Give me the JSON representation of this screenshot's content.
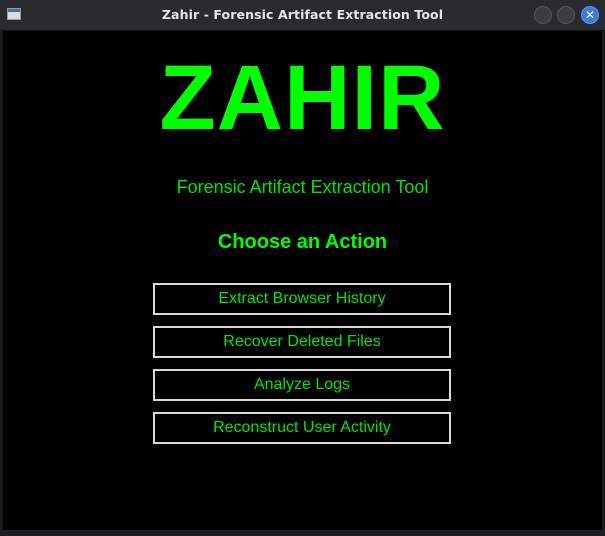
{
  "window": {
    "title": "Zahir - Forensic Artifact Extraction Tool",
    "app_icon": "window-icon",
    "controls": {
      "minimize_icon": "circle-icon",
      "maximize_icon": "circle-icon",
      "close_glyph": "✕"
    }
  },
  "main": {
    "logo": "ZAHIR",
    "subtitle": "Forensic Artifact Extraction Tool",
    "heading": "Choose an Action",
    "actions": [
      {
        "label": "Extract Browser History"
      },
      {
        "label": "Recover Deleted Files"
      },
      {
        "label": "Analyze Logs"
      },
      {
        "label": "Reconstruct User Activity"
      }
    ]
  },
  "colors": {
    "accent": "#00ff00",
    "background": "#000000",
    "button_border": "#d8d8d8",
    "titlebar": "#2a2b2e",
    "close_button": "#3d7be0"
  }
}
